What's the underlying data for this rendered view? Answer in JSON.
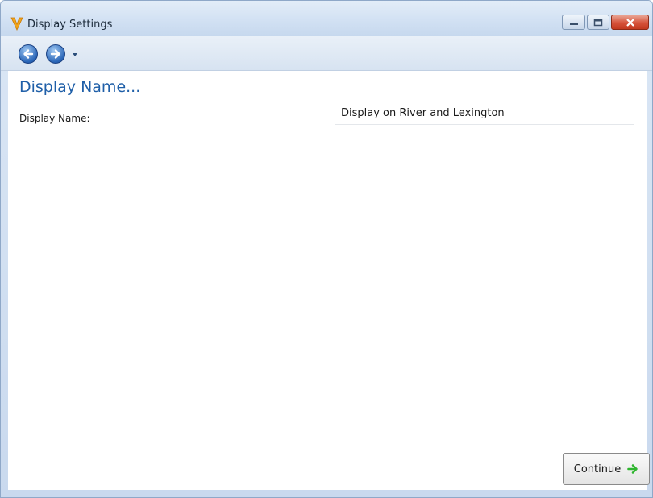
{
  "window": {
    "title": "Display Settings",
    "icons": {
      "app": "app-v-icon",
      "minimize": "minimize-icon",
      "maximize": "maximize-icon",
      "close": "close-icon"
    }
  },
  "nav": {
    "back_icon": "back-arrow-icon",
    "forward_icon": "forward-arrow-icon",
    "history_icon": "chevron-down-icon"
  },
  "page": {
    "heading": "Display Name...",
    "field_label": "Display Name:",
    "field_value": "Display on River and Lexington"
  },
  "footer": {
    "continue_label": "Continue",
    "continue_icon": "arrow-right-icon"
  },
  "colors": {
    "accent": "#1f5fa8",
    "continue_arrow": "#2fb52f",
    "close_button": "#c2391f"
  }
}
